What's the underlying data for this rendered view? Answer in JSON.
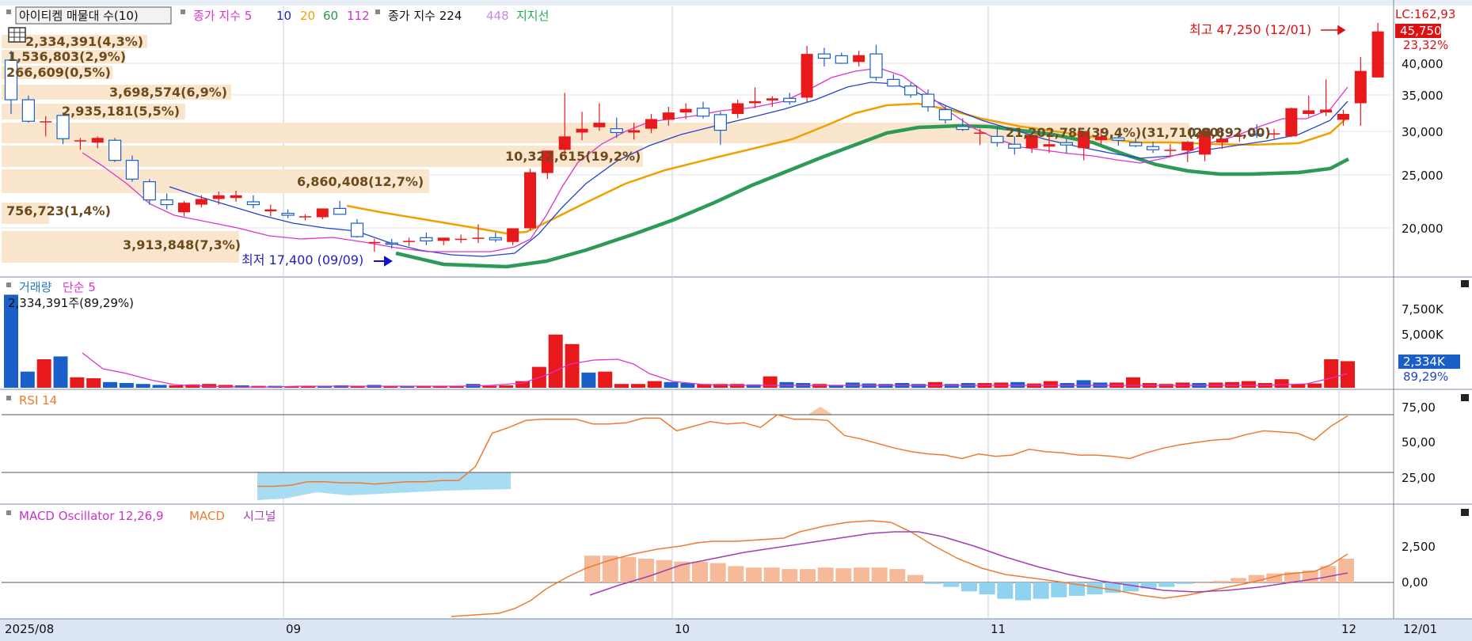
{
  "price_panel": {
    "legend": {
      "indicator_box": "아이티켐 매물대 수(10)",
      "ma_title": "종가 지수 5",
      "ma_periods": [
        "10",
        "20",
        "60",
        "112"
      ],
      "ma_colors": [
        "#2222cc",
        "#f0a000",
        "#2a9a4a",
        "#cc33cc"
      ],
      "ma2_title": "종가 지수 224",
      "ma2_period": "448",
      "ma2_color": "#cc88ee",
      "support_label": "지지선"
    },
    "high_annotation": "최고 47,250 (12/01)",
    "low_annotation": "최저 17,400 (09/09)",
    "right_labels": {
      "lc": "LC:162,93",
      "current": "45,750",
      "change": "23,32%"
    },
    "y_ticks": [
      "40,000",
      "35,000",
      "30,000",
      "25,000",
      "20,000"
    ],
    "volume_profile": [
      {
        "label": "2,334,391(4,3%)",
        "level": 44500,
        "pct": 4.3
      },
      {
        "label": "1,536,803(2,9%)",
        "level": 42300,
        "pct": 2.9
      },
      {
        "label": "266,609(0,5%)",
        "level": 40200,
        "pct": 0.5
      },
      {
        "label": "3,698,574(6,9%)",
        "level": 37400,
        "pct": 6.9
      },
      {
        "label": "2,935,181(5,5%)",
        "level": 35100,
        "pct": 5.5
      },
      {
        "label": "21,202,785(39,4%)(31,710,00)",
        "level": 30700,
        "pct": 39.4
      },
      {
        "label": "10,322,615(19,2%)",
        "level": 28000,
        "pct": 19.2
      },
      {
        "label": "6,860,408(12,7%)",
        "level": 25400,
        "pct": 12.7
      },
      {
        "label": "756,723(1,4%)",
        "level": 21800,
        "pct": 1.4
      },
      {
        "label": "3,913,848(7,3%)",
        "level": 17800,
        "pct": 7.3
      }
    ],
    "support_label_value": "(28,892,00)"
  },
  "volume_panel": {
    "title_a": "거래량",
    "title_b": "단순 5",
    "info": "2,334,391주(89,29%)",
    "y_ticks": [
      "7,500K",
      "5,000K"
    ],
    "right_labels": {
      "current": "2,334K",
      "pct": "89,29%"
    }
  },
  "rsi_panel": {
    "title": "RSI 14",
    "y_ticks": [
      "75,00",
      "50,00",
      "25,00"
    ]
  },
  "macd_panel": {
    "title_a": "MACD Oscillator 12,26,9",
    "title_b": "MACD",
    "title_c": "시그널",
    "y_ticks": [
      "2,500",
      "0,00"
    ]
  },
  "x_axis": {
    "labels": [
      "2025/08",
      "09",
      "10",
      "11",
      "12"
    ],
    "right_label": "12/01"
  },
  "chart_data": [
    {
      "type": "candlestick",
      "title": "아이티켐",
      "ylim": [
        15000,
        49000
      ],
      "candles": [
        [
          41000,
          42500,
          33000,
          35000
        ],
        [
          35000,
          35600,
          31800,
          32000
        ],
        [
          32000,
          32700,
          30000,
          32000
        ],
        [
          32800,
          33200,
          29000,
          29700
        ],
        [
          29500,
          29800,
          28300,
          29500
        ],
        [
          29200,
          30000,
          28500,
          29800
        ],
        [
          29500,
          29800,
          26800,
          27000
        ],
        [
          27000,
          27600,
          24500,
          24800
        ],
        [
          24500,
          24800,
          22000,
          22500
        ],
        [
          22500,
          23200,
          21500,
          22000
        ],
        [
          21200,
          22400,
          20800,
          22200
        ],
        [
          22000,
          23000,
          21700,
          22600
        ],
        [
          22600,
          23400,
          22000,
          23000
        ],
        [
          22700,
          23500,
          22300,
          23000
        ],
        [
          22300,
          23000,
          21600,
          22000
        ],
        [
          21300,
          22000,
          20800,
          21500
        ],
        [
          21100,
          21500,
          20600,
          20900
        ],
        [
          20700,
          21000,
          20400,
          20800
        ],
        [
          20700,
          21600,
          20500,
          21600
        ],
        [
          21600,
          22400,
          21000,
          21000
        ],
        [
          20100,
          20500,
          18700,
          18800
        ],
        [
          18200,
          18600,
          17400,
          18300
        ],
        [
          18200,
          18600,
          17700,
          18100
        ],
        [
          18300,
          18700,
          17900,
          18400
        ],
        [
          18700,
          19200,
          18000,
          18400
        ],
        [
          18400,
          18700,
          18000,
          18700
        ],
        [
          18500,
          19000,
          18200,
          18600
        ],
        [
          18600,
          20000,
          18200,
          18700
        ],
        [
          18700,
          19200,
          18300,
          18500
        ],
        [
          18300,
          19200,
          18000,
          19600
        ],
        [
          19600,
          26000,
          19400,
          25600
        ],
        [
          25500,
          27500,
          24800,
          28200
        ],
        [
          28300,
          36000,
          27700,
          30000
        ],
        [
          30500,
          33300,
          29500,
          31000
        ],
        [
          31200,
          34500,
          30700,
          31800
        ],
        [
          31000,
          32500,
          29800,
          30500
        ],
        [
          30500,
          31800,
          29600,
          30800
        ],
        [
          31000,
          33000,
          30400,
          32300
        ],
        [
          32200,
          34000,
          31400,
          33200
        ],
        [
          33200,
          34500,
          32300,
          33700
        ],
        [
          33800,
          34700,
          32400,
          32700
        ],
        [
          32900,
          33300,
          28900,
          30800
        ],
        [
          33000,
          35000,
          32400,
          34500
        ],
        [
          34500,
          36800,
          33800,
          34800
        ],
        [
          34900,
          35500,
          34000,
          35200
        ],
        [
          35200,
          36000,
          34300,
          34700
        ],
        [
          35300,
          43300,
          34600,
          42000
        ],
        [
          42000,
          43000,
          40000,
          41300
        ],
        [
          41700,
          42200,
          40400,
          40500
        ],
        [
          40700,
          42500,
          40000,
          41800
        ],
        [
          42000,
          43500,
          37800,
          38300
        ],
        [
          38000,
          38800,
          37000,
          37000
        ],
        [
          37000,
          37500,
          35300,
          35700
        ],
        [
          35800,
          36500,
          33300,
          34000
        ],
        [
          33600,
          34200,
          31700,
          32200
        ],
        [
          31300,
          32400,
          30700,
          30900
        ],
        [
          30500,
          31000,
          28900,
          30500
        ],
        [
          30000,
          31200,
          28700,
          29200
        ],
        [
          29000,
          30000,
          27700,
          28500
        ],
        [
          28500,
          30200,
          27900,
          30200
        ],
        [
          28700,
          30500,
          27900,
          29000
        ],
        [
          29200,
          29700,
          27800,
          28900
        ],
        [
          28500,
          30700,
          27000,
          30700
        ],
        [
          29500,
          31000,
          29000,
          30000
        ],
        [
          29800,
          30300,
          28800,
          29500
        ],
        [
          29200,
          29800,
          28600,
          28800
        ],
        [
          28700,
          29300,
          27900,
          28300
        ],
        [
          28300,
          29000,
          27400,
          28300
        ],
        [
          28200,
          29400,
          26800,
          29300
        ],
        [
          27700,
          30000,
          26900,
          30700
        ],
        [
          29200,
          29800,
          28400,
          29700
        ],
        [
          30000,
          30900,
          29300,
          30200
        ],
        [
          30300,
          31600,
          29800,
          30200
        ],
        [
          30300,
          31000,
          29700,
          30400
        ],
        [
          30000,
          33900,
          29900,
          33800
        ],
        [
          33000,
          35600,
          32600,
          33500
        ],
        [
          33200,
          38000,
          32700,
          33600
        ],
        [
          32200,
          33600,
          31400,
          33000
        ],
        [
          34500,
          41500,
          31400,
          39300
        ],
        [
          38300,
          47250,
          38300,
          45750
        ]
      ]
    },
    {
      "type": "bar",
      "title": "거래량",
      "ylim": [
        0,
        10000
      ],
      "values": [
        9800,
        1700,
        3000,
        3300,
        1100,
        1000,
        600,
        500,
        400,
        300,
        250,
        350,
        400,
        300,
        250,
        200,
        200,
        150,
        150,
        200,
        250,
        150,
        300,
        200,
        150,
        200,
        150,
        150,
        400,
        200,
        250,
        700,
        2200,
        5600,
        4600,
        1600,
        1700,
        400,
        400,
        700,
        600,
        500,
        400,
        400,
        400,
        350,
        1200,
        600,
        500,
        400,
        300,
        550,
        450,
        400,
        500,
        400,
        600,
        400,
        500,
        500,
        550,
        600,
        450,
        700,
        500,
        800,
        550,
        550,
        1100,
        500,
        400,
        550,
        500,
        550,
        600,
        700,
        500,
        900,
        400,
        450,
        3000,
        2800
      ]
    },
    {
      "type": "line",
      "title": "RSI 14",
      "ylim": [
        0,
        100
      ],
      "values": [
        13,
        13,
        14,
        17,
        17,
        16,
        16,
        15,
        16,
        17,
        17,
        18,
        18,
        30,
        59,
        64,
        70,
        71,
        71,
        71,
        67,
        67,
        68,
        72,
        72,
        61,
        65,
        69,
        67,
        68,
        64,
        75,
        71,
        71,
        70,
        57,
        54,
        50,
        46,
        43,
        41,
        40,
        37,
        41,
        39,
        40,
        45,
        43,
        42,
        40,
        40,
        39,
        37,
        42,
        46,
        49,
        51,
        53,
        54,
        58,
        61,
        60,
        59,
        53,
        65,
        74
      ]
    },
    {
      "type": "bar",
      "title": "MACD Oscillator 12,26,9",
      "ylim": [
        -1500,
        4000
      ],
      "values": [
        1800,
        1800,
        1700,
        1600,
        1500,
        1400,
        1400,
        1300,
        1100,
        1000,
        1000,
        900,
        900,
        1000,
        950,
        1000,
        1000,
        900,
        500,
        -100,
        -300,
        -600,
        -800,
        -1100,
        -1200,
        -1100,
        -1000,
        -900,
        -800,
        -700,
        -600,
        -400,
        -300,
        -100,
        0,
        100,
        300,
        500,
        600,
        700,
        800,
        1100,
        1600
      ]
    }
  ]
}
